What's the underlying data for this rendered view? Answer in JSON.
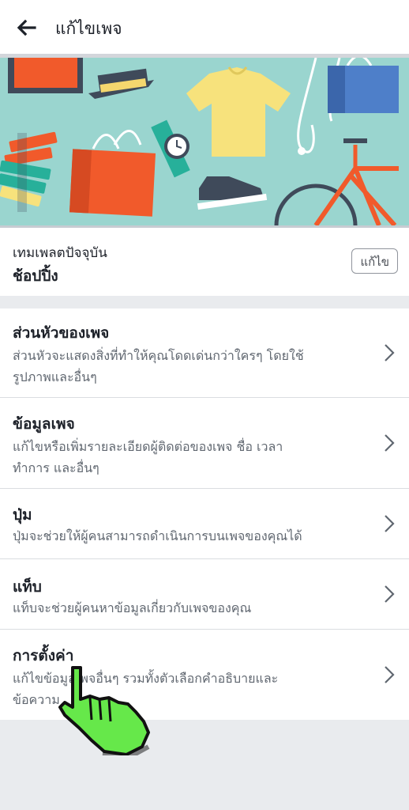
{
  "header": {
    "title": "แก้ไขเพจ"
  },
  "template": {
    "caption": "เทมเพลตปัจจุบัน",
    "value": "ช้อปปิ้ง",
    "edit_label": "แก้ไข"
  },
  "menu": {
    "items": [
      {
        "title": "ส่วนหัวของเพจ",
        "desc_line1": "ส่วนหัวจะแสดงสิ่งที่ทำให้คุณโดดเด่นกว่าใครๆ โดยใช้",
        "desc_line2": "รูปภาพและอื่นๆ"
      },
      {
        "title": "ข้อมูลเพจ",
        "desc_line1": "แก้ไขหรือเพิ่มรายละเอียดผู้ติดต่อของเพจ ชื่อ เวลา",
        "desc_line2": "ทำการ และอื่นๆ"
      },
      {
        "title": "ปุ่ม",
        "desc_line1": "ปุ่มจะช่วยให้ผู้คนสามารถดำเนินการบนเพจของคุณได้",
        "desc_line2": ""
      },
      {
        "title": "แท็บ",
        "desc_line1": "แท็บจะช่วยผู้คนหาข้อมูลเกี่ยวกับเพจของคุณ",
        "desc_line2": ""
      },
      {
        "title": "การตั้งค่า",
        "desc_line1": "แก้ไขข้อมูลเพจอื่นๆ รวมทั้งตัวเลือกคำอธิบายและ",
        "desc_line2": "ข้อความ"
      }
    ]
  },
  "colors": {
    "hero_bg": "#9ad5cf",
    "page_bg": "#e9ebee",
    "pointer": "#66e84a"
  }
}
